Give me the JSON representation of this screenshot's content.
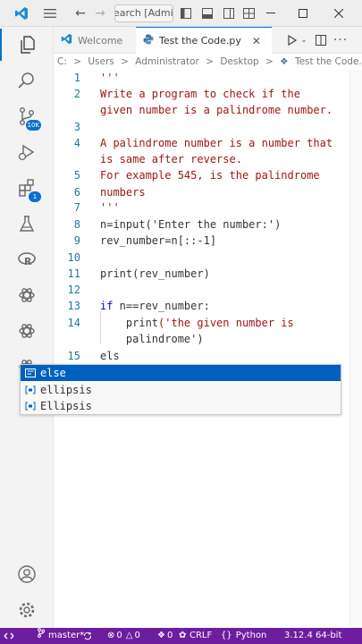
{
  "titlebar": {
    "search_text": "earch [Adminis"
  },
  "activity": {
    "source_control_badge": "10K",
    "extensions_badge": "1"
  },
  "tabs": [
    {
      "label": "Welcome"
    },
    {
      "label": "Test the Code.py"
    }
  ],
  "breadcrumb": [
    "C:",
    ">",
    "Users",
    ">",
    "Administrator",
    ">",
    "Desktop",
    ">",
    "Test the Code.py",
    ">",
    "..."
  ],
  "editor": {
    "lines": [
      {
        "n": "1",
        "text": "'''"
      },
      {
        "n": "2",
        "text": "Write a program to check if the"
      },
      {
        "n": "",
        "text": "given number is a palindrome number."
      },
      {
        "n": "3",
        "text": ""
      },
      {
        "n": "4",
        "text": "A palindrome number is a number that"
      },
      {
        "n": "",
        "text": "is same after reverse."
      },
      {
        "n": "5",
        "text": "For example 545, is the palindrome"
      },
      {
        "n": "6",
        "text": "numbers"
      },
      {
        "n": "7",
        "text": "'''"
      },
      {
        "n": "8",
        "text": "n=input('Enter the number:')"
      },
      {
        "n": "9",
        "text": "rev_number=n[::-1]"
      },
      {
        "n": "10",
        "text": ""
      },
      {
        "n": "11",
        "text": "print(rev_number)"
      },
      {
        "n": "12",
        "text": ""
      },
      {
        "n": "13",
        "text": "if n==rev_number:"
      },
      {
        "n": "14",
        "text": "    print('the given number is"
      },
      {
        "n": "",
        "text": "    palindrome')"
      },
      {
        "n": "15",
        "text": "els"
      }
    ]
  },
  "suggest": [
    {
      "label": "else",
      "selected": true
    },
    {
      "label": "ellipsis",
      "selected": false
    },
    {
      "label": "Ellipsis",
      "selected": false
    }
  ],
  "statusbar": {
    "branch": "master*",
    "errors": "0",
    "warnings": "0",
    "ports": "0",
    "line_ending": "CRLF",
    "language": "Python",
    "interpreter": "3.12.4 64-bit"
  },
  "colors": {
    "accent": "#0d6fcf",
    "statusbar": "#6d1e9e",
    "string": "#a31515",
    "keyword": "#0000ff",
    "line_number": "#237893",
    "suggest_selected": "#0060c0"
  }
}
